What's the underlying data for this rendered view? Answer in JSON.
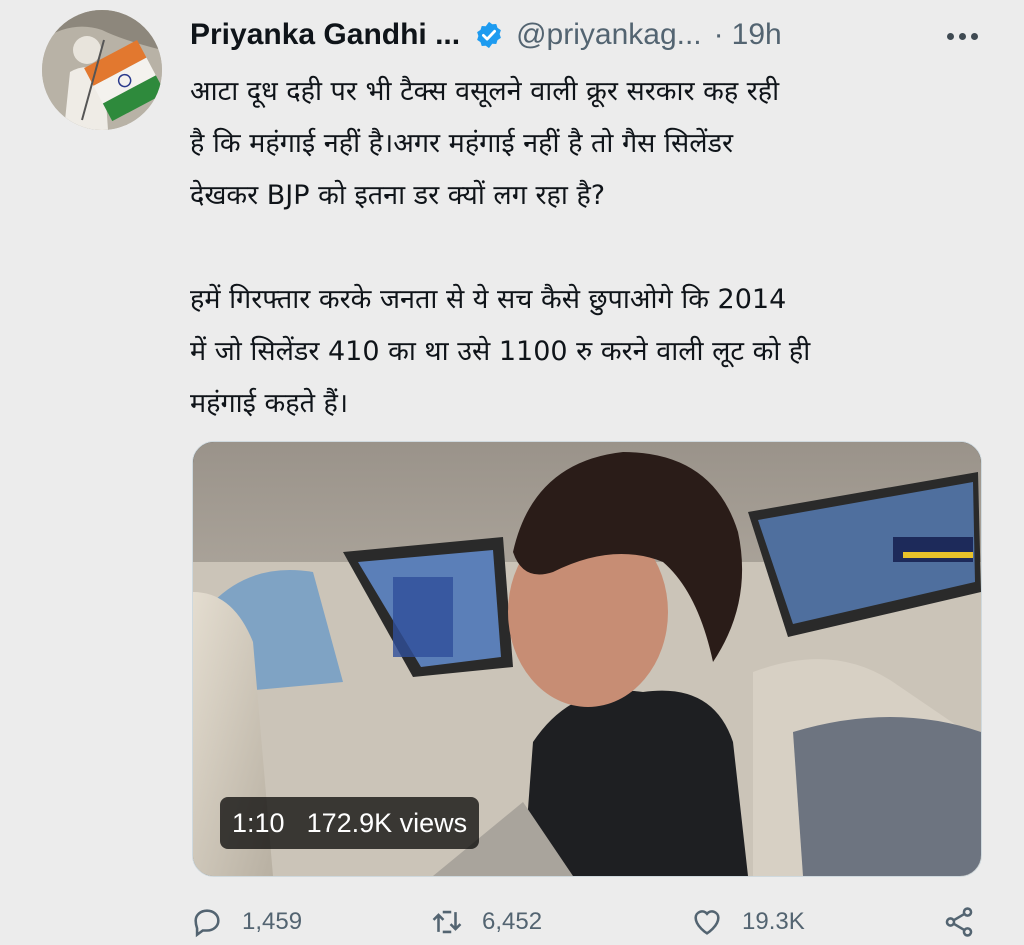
{
  "tweet": {
    "author_name": "Priyanka Gandhi ...",
    "handle": "@priyankag...",
    "separator": "·",
    "timestamp": "19h",
    "text_lines": [
      "आटा दूध दही पर भी टैक्स वसूलने वाली क्रूर सरकार कह रही",
      "है कि महंगाई नहीं है।अगर महंगाई नहीं है तो गैस सिलेंडर",
      "देखकर BJP को इतना डर क्यों लग रहा है?",
      "हमें गिरफ्तार करके जनता से ये सच कैसे छुपाओगे कि 2014",
      "में जो सिलेंडर 410 का था उसे 1100 रु करने वाली लूट को ही",
      "महंगाई कहते हैं।"
    ],
    "media": {
      "duration": "1:10",
      "views": "172.9K views"
    },
    "actions": {
      "replies": "1,459",
      "retweets": "6,452",
      "likes": "19.3K"
    }
  },
  "icons": {
    "verified": "verified-badge-icon",
    "more": "more-options-icon",
    "reply": "reply-icon",
    "retweet": "retweet-icon",
    "like": "heart-icon",
    "share": "share-icon"
  },
  "colors": {
    "background": "#ececec",
    "text": "#0f1419",
    "secondary": "#536471",
    "verified": "#1d9bf0"
  }
}
